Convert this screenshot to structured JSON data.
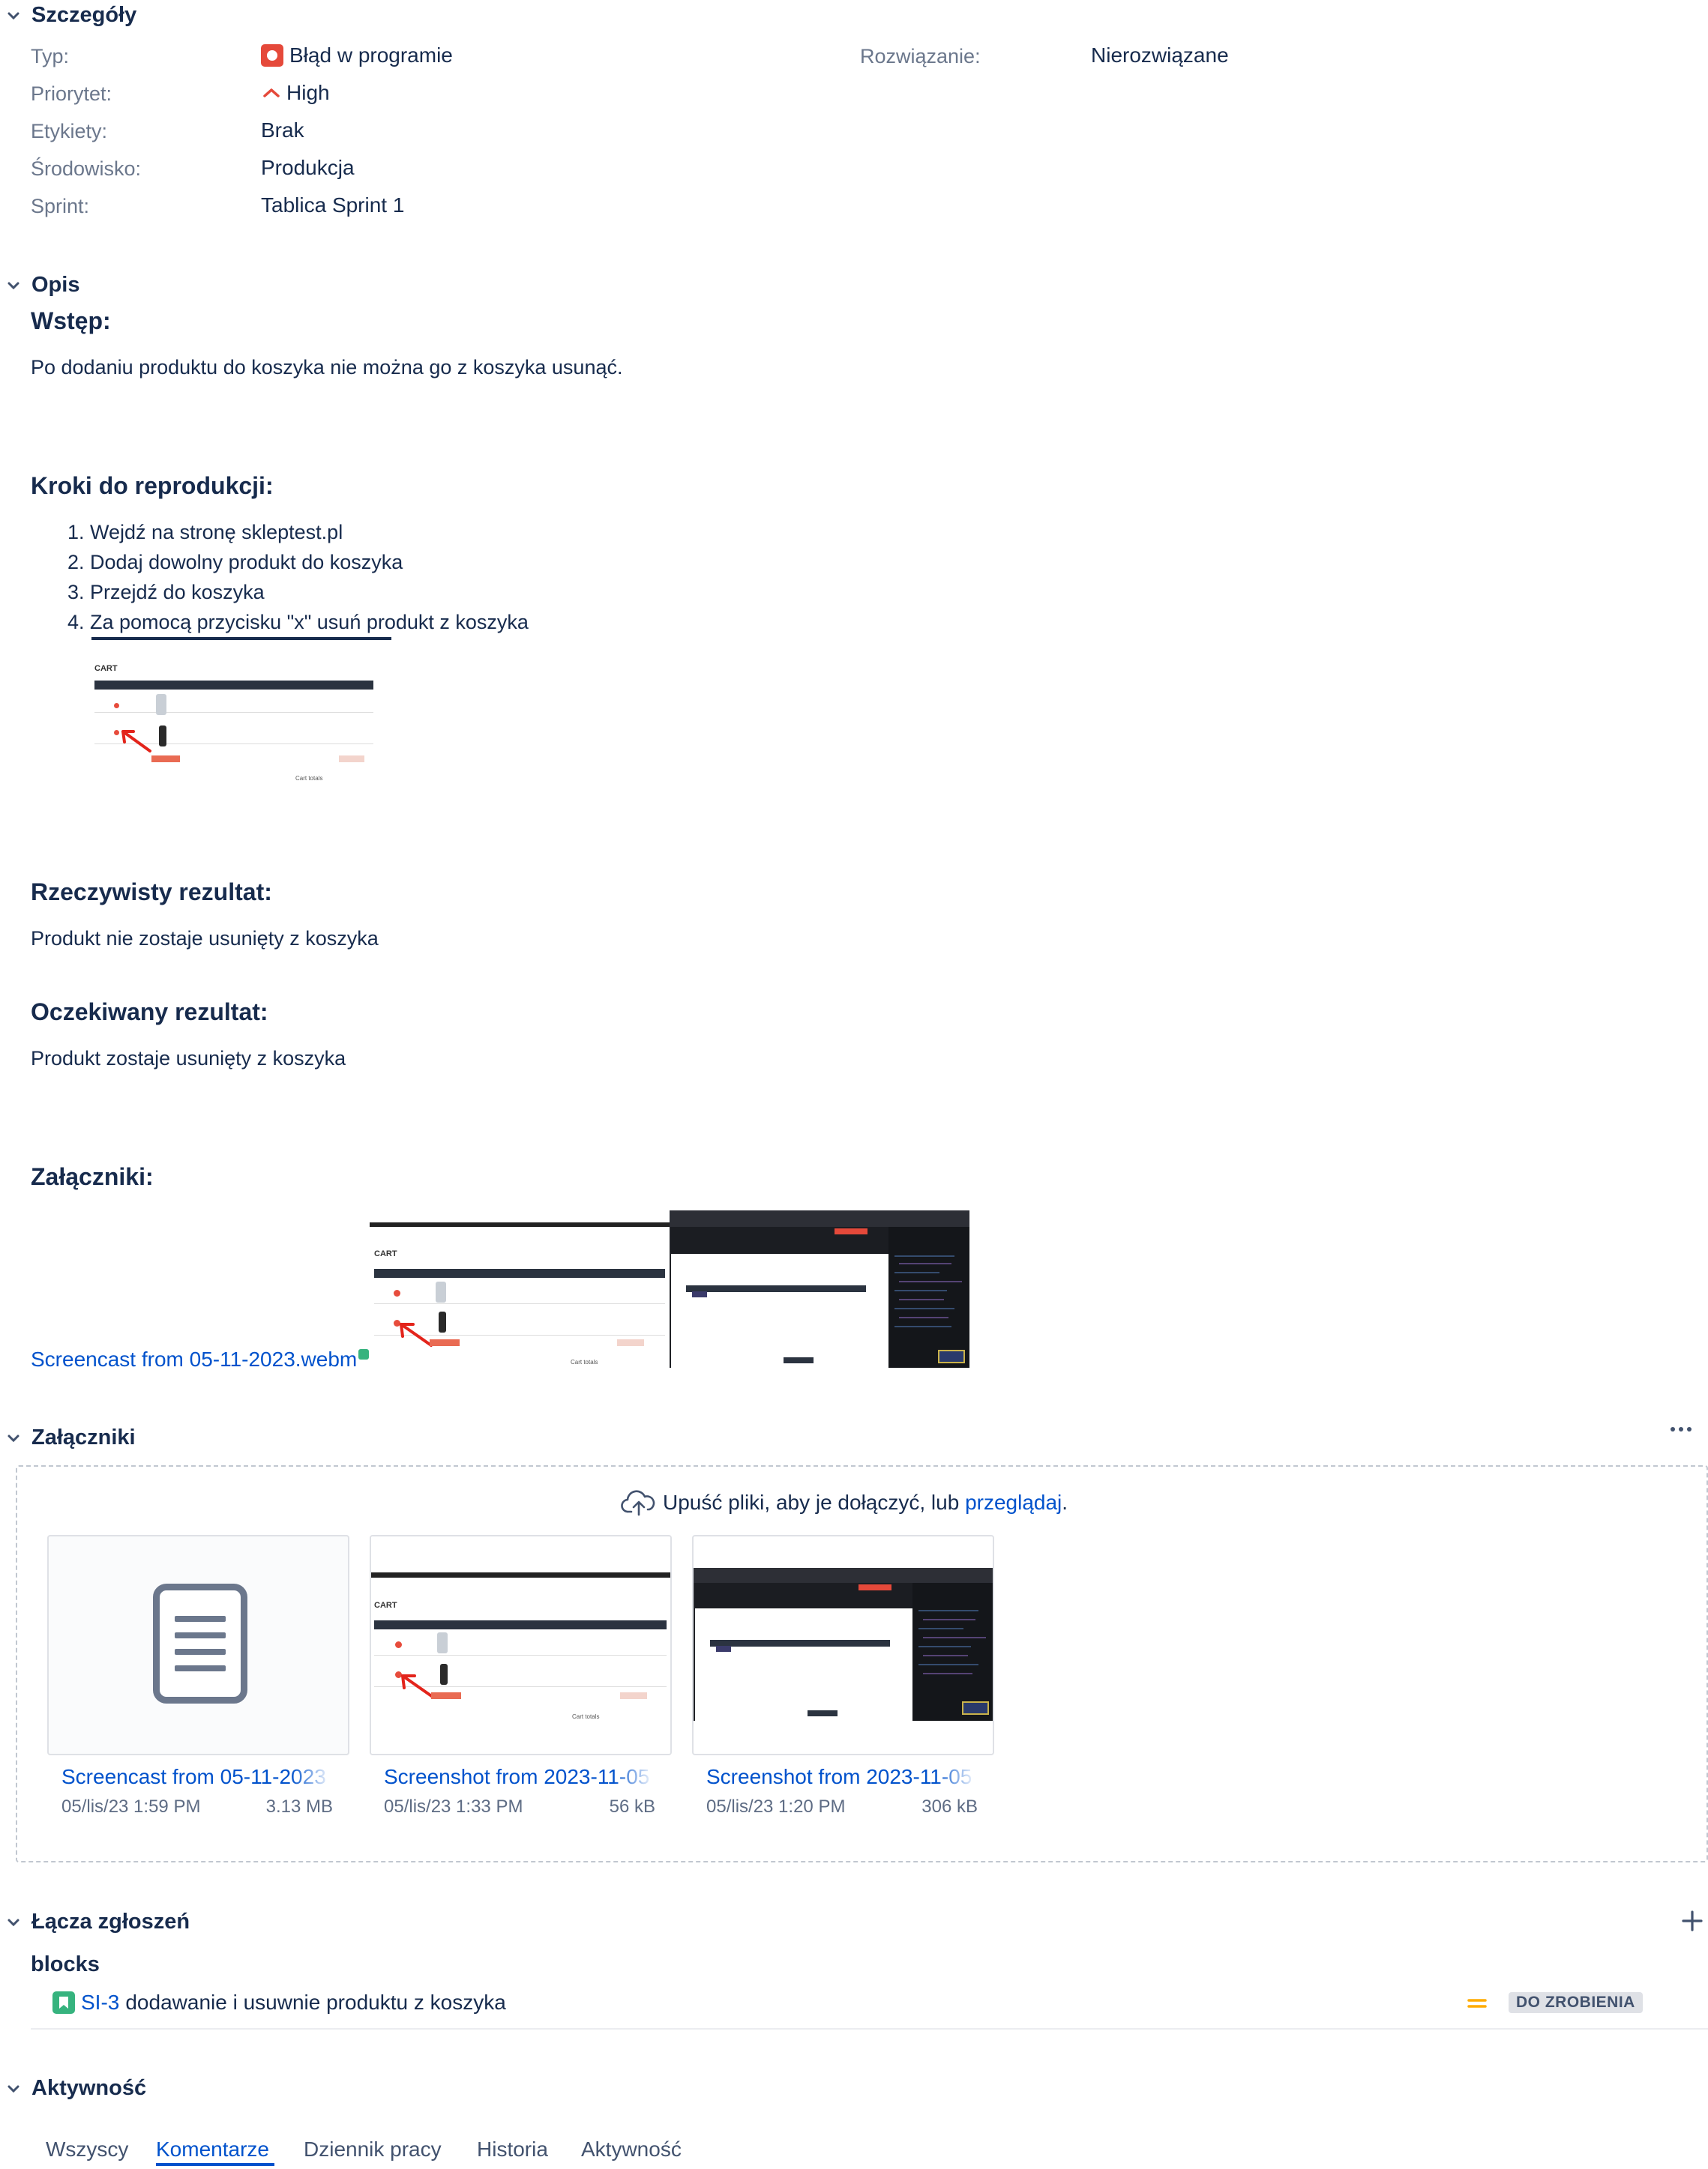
{
  "details": {
    "heading": "Szczegóły",
    "type_label": "Typ:",
    "type_value": "Błąd w programie",
    "resolution_label": "Rozwiązanie:",
    "resolution_value": "Nierozwiązane",
    "priority_label": "Priorytet:",
    "priority_value": "High",
    "labels_label": "Etykiety:",
    "labels_value": "Brak",
    "env_label": "Środowisko:",
    "env_value": "Produkcja",
    "sprint_label": "Sprint:",
    "sprint_value": "Tablica Sprint 1"
  },
  "description": {
    "heading": "Opis",
    "intro_title": "Wstęp:",
    "intro_text": "Po dodaniu produktu do koszyka nie można go z koszyka usunąć.",
    "steps_title": "Kroki do reprodukcji:",
    "steps": [
      "1. Wejdź na stronę skleptest.pl",
      "2. Dodaj dowolny produkt do koszyka",
      "3. Przejdź do koszyka",
      "4. Za pomocą przycisku \"x\" usuń produkt z koszyka"
    ],
    "actual_title": "Rzeczywisty rezultat:",
    "actual_text": "Produkt nie zostaje usunięty z koszyka",
    "expected_title": "Oczekiwany rezultat:",
    "expected_text": "Produkt zostaje usunięty z koszyka",
    "attachments_title": "Załączniki:",
    "attachment_link": "Screencast from 05-11-2023.webm"
  },
  "cart_shot": {
    "title": "CART",
    "totals": "Cart totals"
  },
  "attachments": {
    "heading": "Załączniki",
    "more_icon": "more-icon",
    "drop_text": "Upuść pliki, aby je dołączyć, lub ",
    "browse_link": "przeglądaj",
    "drop_end": ".",
    "files": [
      {
        "name": "Screencast from 05-11-2023",
        "date": "05/lis/23 1:59 PM",
        "size": "3.13 MB"
      },
      {
        "name": "Screenshot from 2023-11-05",
        "date": "05/lis/23 1:33 PM",
        "size": "56 kB"
      },
      {
        "name": "Screenshot from 2023-11-05",
        "date": "05/lis/23 1:20 PM",
        "size": "306 kB"
      }
    ]
  },
  "links": {
    "heading": "Łącza zgłoszeń",
    "add_icon": "plus-icon",
    "relation": "blocks",
    "issue_key": "SI-3",
    "issue_title": "dodawanie i usuwnie produktu z koszyka",
    "status": "DO ZROBIENIA"
  },
  "activity": {
    "heading": "Aktywność",
    "tabs": [
      "Wszyscy",
      "Komentarze",
      "Dziennik pracy",
      "Historia",
      "Aktywność"
    ],
    "active_tab": "Komentarze"
  },
  "colors": {
    "link": "#0052cc",
    "bug": "#e5493a",
    "priority": "#e5493a",
    "story": "#36b37e",
    "medium_priority": "#ffab00"
  }
}
